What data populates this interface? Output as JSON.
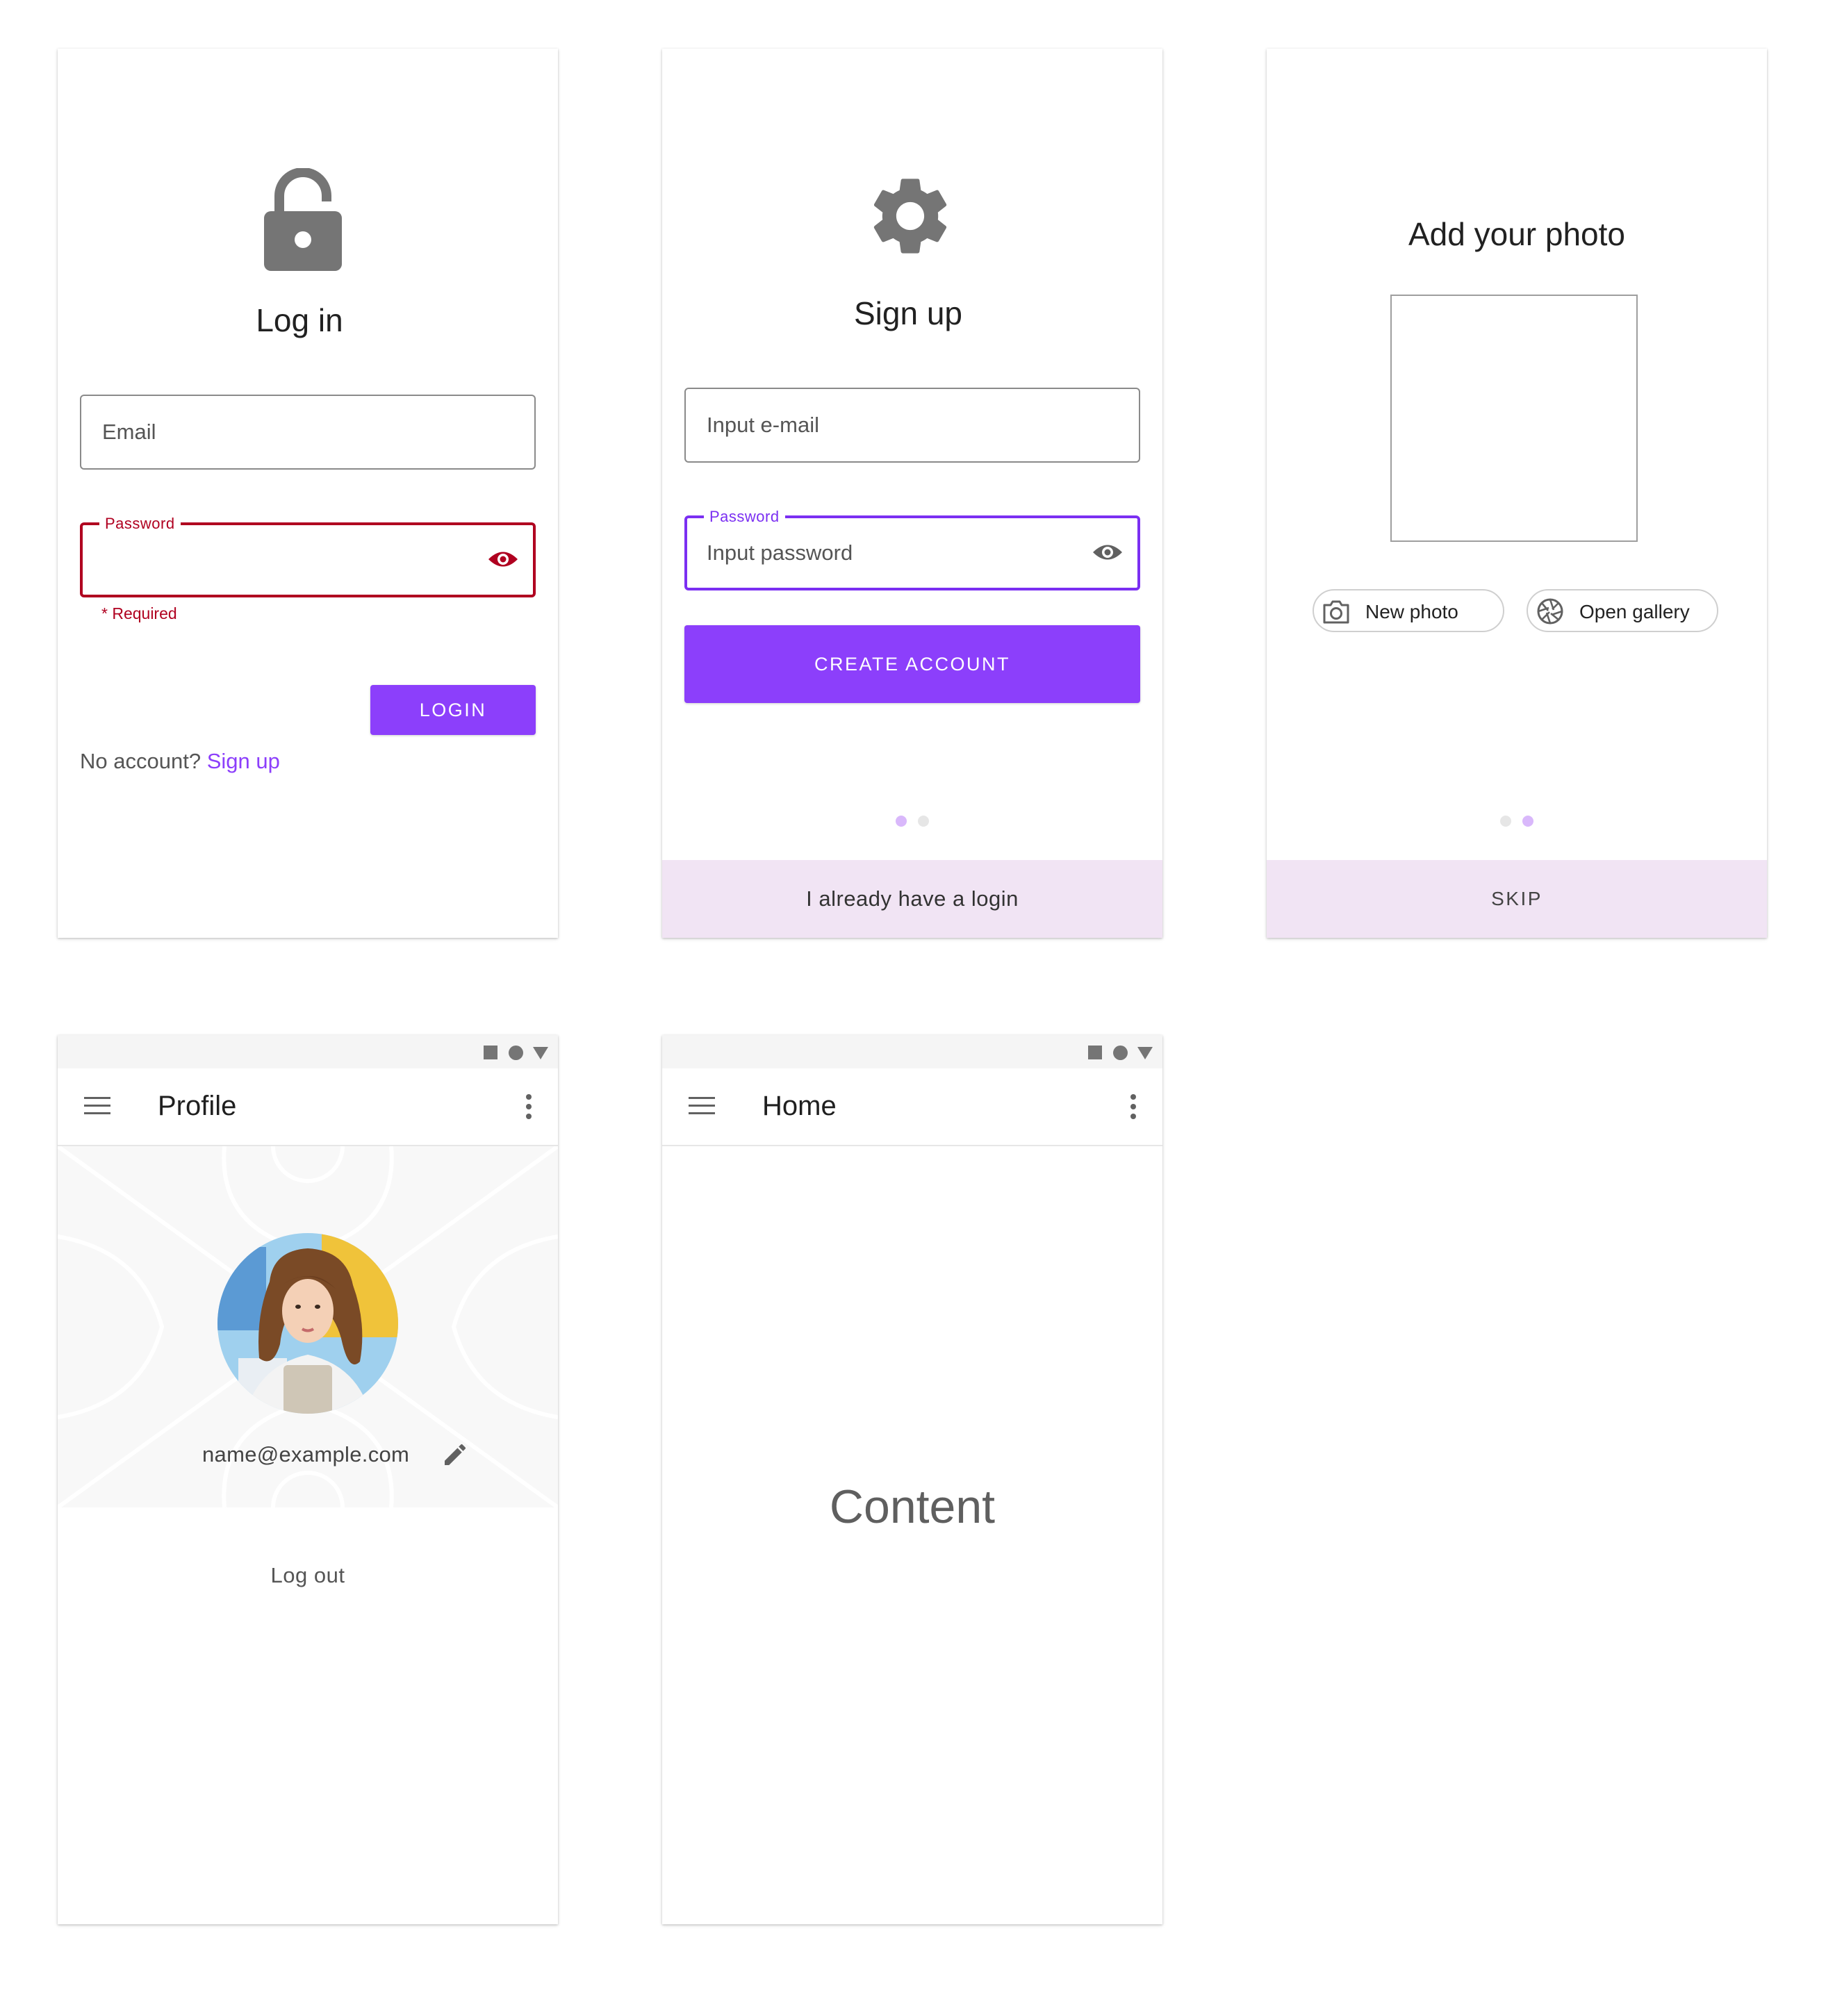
{
  "colors": {
    "accent": "#8c3ffb",
    "error": "#b00020",
    "bottom_bar": "#f1e4f4",
    "page_dot_active": "#d9b8fb",
    "icon_gray": "#757575"
  },
  "login": {
    "icon": "lock-open-icon",
    "title": "Log in",
    "email_label": "Email",
    "password_label": "Password",
    "password_helper": "* Required",
    "no_account_text": "No account?",
    "signup_link": "Sign up",
    "login_button": "LOGIN"
  },
  "signup": {
    "icon": "gear-icon",
    "title": "Sign up",
    "email_placeholder": "Input e-mail",
    "password_label": "Password",
    "password_placeholder": "Input password",
    "create_button": "CREATE ACCOUNT",
    "bottom_link": "I already have a login",
    "page_indicator": {
      "active": 1,
      "total": 2
    }
  },
  "photo": {
    "title": "Add your photo",
    "new_photo": "New photo",
    "open_gallery": "Open gallery",
    "skip": "SKIP",
    "page_indicator": {
      "active": 2,
      "total": 2
    }
  },
  "profile": {
    "status_icons": [
      "square-icon",
      "circle-icon",
      "triangle-icon"
    ],
    "title": "Profile",
    "email": "name@example.com",
    "logout": "Log out"
  },
  "home": {
    "status_icons": [
      "square-icon",
      "circle-icon",
      "triangle-icon"
    ],
    "title": "Home",
    "content": "Content"
  }
}
